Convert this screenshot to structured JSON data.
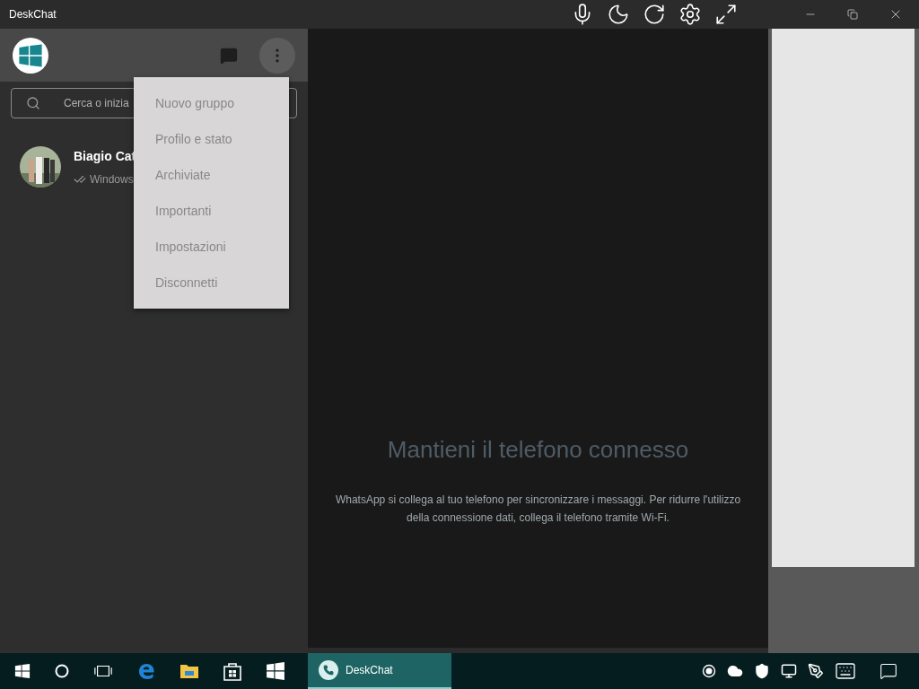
{
  "window": {
    "title": "DeskChat"
  },
  "sidebar": {
    "search": {
      "value": "Cerca o inizia"
    },
    "chats": [
      {
        "name": "Biagio Cat",
        "preview": "Windows"
      }
    ]
  },
  "menu": {
    "items": [
      {
        "label": "Nuovo gruppo"
      },
      {
        "label": "Profilo e stato"
      },
      {
        "label": "Archiviate"
      },
      {
        "label": "Importanti"
      },
      {
        "label": "Impostazioni"
      },
      {
        "label": "Disconnetti"
      }
    ]
  },
  "main": {
    "heading": "Mantieni il telefono connesso",
    "body": "WhatsApp si collega al tuo telefono per sincronizzare i messaggi. Per ridurre l'utilizzo della connessione dati, collega il telefono tramite Wi-Fi."
  },
  "taskbar": {
    "apps": [
      {
        "label": "DeskChat",
        "selected": true
      }
    ]
  }
}
